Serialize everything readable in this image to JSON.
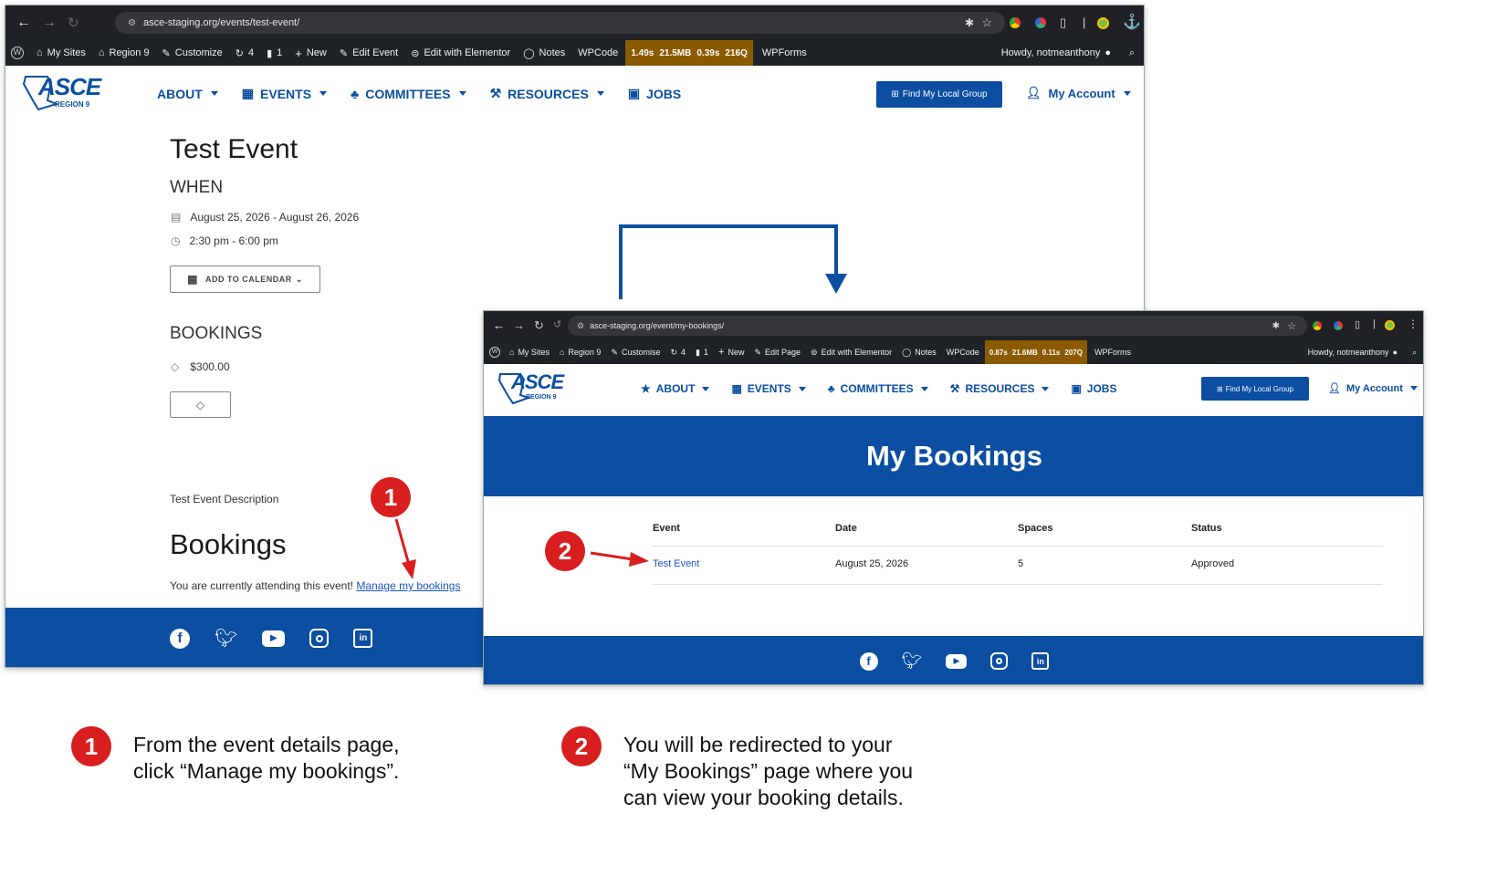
{
  "win1": {
    "url": "asce-staging.org/events/test-event/",
    "wpbar": {
      "items": [
        "My Sites",
        "Region 9",
        "Customize",
        "4",
        "1",
        "New",
        "Edit Event",
        "Edit with Elementor",
        "Notes",
        "WPCode"
      ],
      "perf": [
        "1.49s",
        "21.5MB",
        "0.39s",
        "216Q"
      ],
      "wpforms": "WPForms",
      "howdy": "Howdy, notmeanthony"
    },
    "logo": {
      "asce": "ASCE",
      "region": "REGION 9"
    },
    "menu": [
      "ABOUT",
      "EVENTS",
      "COMMITTEES",
      "RESOURCES",
      "JOBS"
    ],
    "find_btn": "Find My Local Group",
    "account": "My Account",
    "title": "Test Event",
    "when_heading": "WHEN",
    "date_range": "August 25, 2026 - August 26, 2026",
    "time_range": "2:30 pm - 6:00 pm",
    "add_to_calendar": "ADD TO CALENDAR",
    "bookings_heading": "BOOKINGS",
    "price": "$300.00",
    "description": "Test Event Description",
    "bookings_title": "Bookings",
    "attending_text": "You are currently attending this event!",
    "manage_link": "Manage my bookings"
  },
  "win2": {
    "url": "asce-staging.org/event/my-bookings/",
    "wpbar": {
      "items": [
        "My Sites",
        "Region 9",
        "Customise",
        "4",
        "1",
        "New",
        "Edit Page",
        "Edit with Elementor",
        "Notes",
        "WPCode"
      ],
      "perf": [
        "0.87s",
        "21.6MB",
        "0.11s",
        "207Q"
      ],
      "wpforms": "WPForms",
      "howdy": "Howdy, notmeanthony"
    },
    "logo": {
      "asce": "ASCE",
      "region": "REGION 9"
    },
    "menu": [
      "ABOUT",
      "EVENTS",
      "COMMITTEES",
      "RESOURCES",
      "JOBS"
    ],
    "find_btn": "Find My Local Group",
    "account": "My Account",
    "hero_title": "My Bookings",
    "table": {
      "headers": [
        "Event",
        "Date",
        "Spaces",
        "Status"
      ],
      "row": [
        "Test Event",
        "August 25, 2026",
        "5",
        "Approved"
      ]
    }
  },
  "steps": [
    {
      "num": "1",
      "line1": "From the event details page,",
      "line2": "click “Manage my bookings”."
    },
    {
      "num": "2",
      "line1": "You will be redirected to your",
      "line2": "“My Bookings” page where you",
      "line3": "can view your booking details."
    }
  ],
  "colors": {
    "brand": "#0b4ea2",
    "callout": "#d81e1e",
    "perf": "#8a5a00"
  }
}
